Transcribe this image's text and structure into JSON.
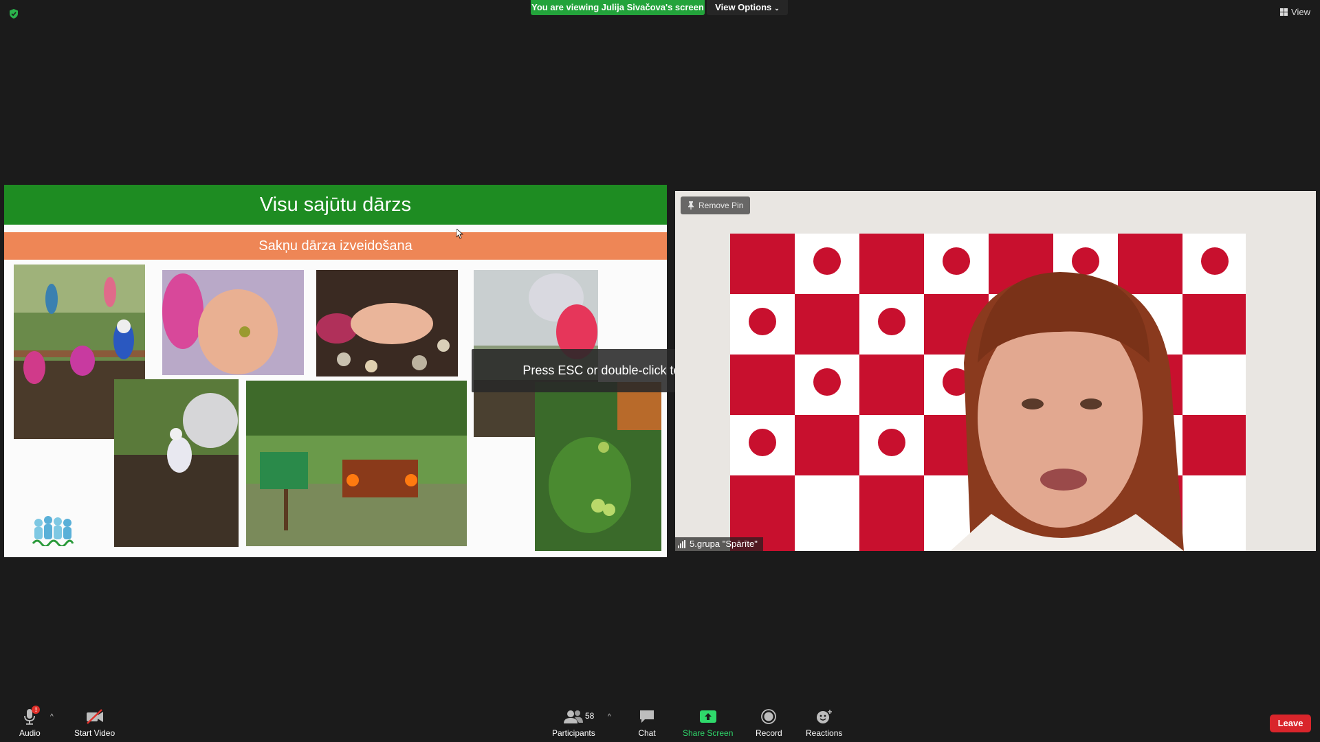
{
  "top_bar": {
    "viewing_banner": "You are viewing Julija Sivačova's screen",
    "view_options_label": "View Options",
    "view_label": "View"
  },
  "slide": {
    "title": "Visu sajūtu dārzs",
    "subtitle": "Sakņu dārza izveidošana"
  },
  "toast": {
    "text": "Press ESC or double-click to exit full screen mode"
  },
  "video": {
    "remove_pin_label": "Remove Pin",
    "participant_name": "5.grupa \"Spārīte\""
  },
  "toolbar": {
    "audio_label": "Audio",
    "audio_badge": "!",
    "start_video_label": "Start Video",
    "participants_label": "Participants",
    "participants_count": "58",
    "chat_label": "Chat",
    "share_screen_label": "Share Screen",
    "record_label": "Record",
    "reactions_label": "Reactions",
    "leave_label": "Leave"
  },
  "colors": {
    "banner_green": "#23a33b",
    "slide_title_green": "#1e8c22",
    "slide_sub_orange": "#ee8656",
    "share_green": "#2fd96b",
    "leave_red": "#d9252b"
  },
  "icons": [
    "shield-icon",
    "chevron-down-icon",
    "grid-view-icon",
    "pin-icon",
    "signal-icon",
    "microphone-icon",
    "caret-up-icon",
    "video-off-icon",
    "participants-icon",
    "chat-icon",
    "share-screen-icon",
    "record-icon",
    "reactions-icon"
  ]
}
